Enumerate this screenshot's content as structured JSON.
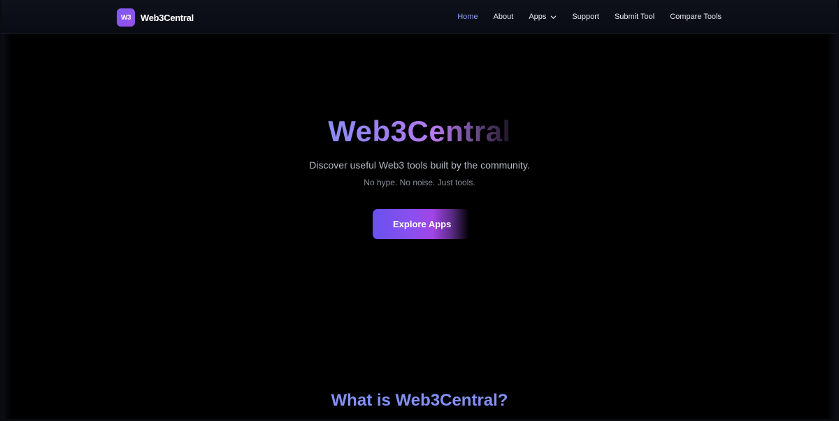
{
  "navbar": {
    "brand": {
      "logo_text": "W3",
      "name": "Web3Central"
    },
    "links": [
      {
        "label": "Home",
        "active": true
      },
      {
        "label": "About",
        "active": false
      },
      {
        "label": "Apps",
        "active": false,
        "dropdown": true
      },
      {
        "label": "Support",
        "active": false
      },
      {
        "label": "Submit Tool",
        "active": false
      },
      {
        "label": "Compare Tools",
        "active": false
      }
    ]
  },
  "hero": {
    "title": "Web3Central",
    "subtitle": "Discover useful Web3 tools built by the community.",
    "tagline": "No hype. No noise. Just tools.",
    "cta_label": "Explore Apps"
  },
  "section": {
    "title": "What is Web3Central?"
  },
  "icons": {
    "apps_dropdown": "chevron-down-icon"
  },
  "colors": {
    "background": "#000000",
    "navbar": "#0e111b",
    "accent": "#8fa0ff",
    "logo_gradient_start": "#7c5cf5",
    "logo_gradient_end": "#9a4dea",
    "section_title": "#8490f4"
  }
}
